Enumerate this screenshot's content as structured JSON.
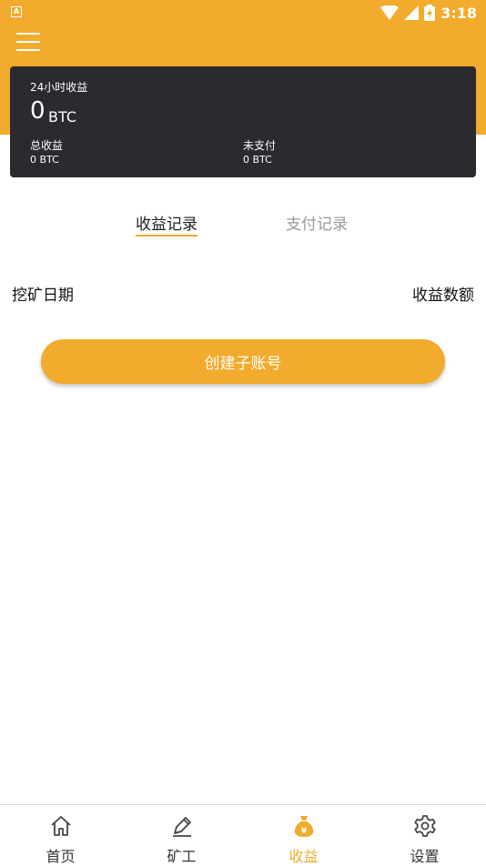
{
  "status_bar": {
    "time": "3:18",
    "badge": "A",
    "icons": [
      "wifi-icon",
      "signal-icon",
      "battery-icon"
    ]
  },
  "header": {
    "menu_icon": "hamburger-menu-icon"
  },
  "summary": {
    "label_24h": "24小时收益",
    "value_24h": "0",
    "unit_24h": "BTC",
    "total_label": "总收益",
    "total_value": "0 BTC",
    "unpaid_label": "未支付",
    "unpaid_value": "0 BTC"
  },
  "tabs": [
    {
      "label": "收益记录",
      "active": true
    },
    {
      "label": "支付记录",
      "active": false
    }
  ],
  "table": {
    "col_date": "挖矿日期",
    "col_amount": "收益数额"
  },
  "create_button": "创建子账号",
  "bottom_nav": [
    {
      "label": "首页",
      "icon": "home-icon",
      "active": false
    },
    {
      "label": "矿工",
      "icon": "pickaxe-icon",
      "active": false
    },
    {
      "label": "收益",
      "icon": "money-bag-icon",
      "active": true
    },
    {
      "label": "设置",
      "icon": "gear-icon",
      "active": false
    }
  ],
  "colors": {
    "accent": "#f2ab2c",
    "card_bg": "#2a2a2f"
  }
}
